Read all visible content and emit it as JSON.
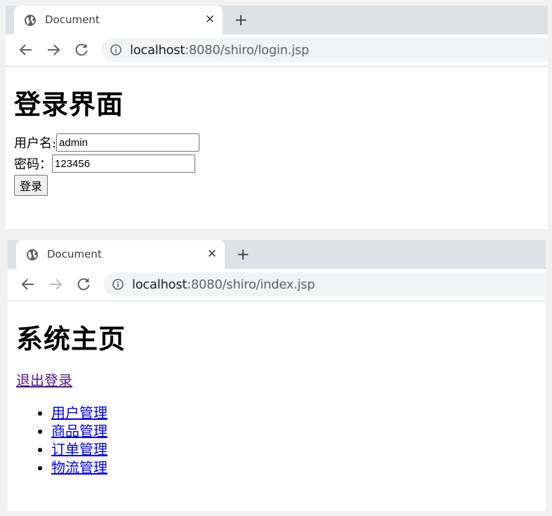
{
  "window1": {
    "tab_title": "Document",
    "tab_close": "✕",
    "new_tab": "+",
    "url_host": "localhost",
    "url_rest": ":8080/shiro/login.jsp",
    "heading": "登录界面",
    "username_label": "用户名:",
    "username_value": "admin",
    "password_label": "密码：",
    "password_value": "123456",
    "login_button": "登录"
  },
  "window2": {
    "tab_title": "Document",
    "tab_close": "✕",
    "new_tab": "+",
    "url_host": "localhost",
    "url_rest": ":8080/shiro/index.jsp",
    "heading": "系统主页",
    "logout_link": "退出登录",
    "menu": [
      "用户管理",
      "商品管理",
      "订单管理",
      "物流管理"
    ]
  },
  "icons": {
    "tab": "globe-icon",
    "back": "arrow-left-icon",
    "forward": "arrow-right-icon",
    "reload": "reload-icon",
    "site_info": "info-icon"
  },
  "colors": {
    "tabbar": "#dee1e6",
    "omnibox": "#f1f3f4",
    "link": "#0000ee",
    "visited_link": "#551a8b"
  }
}
